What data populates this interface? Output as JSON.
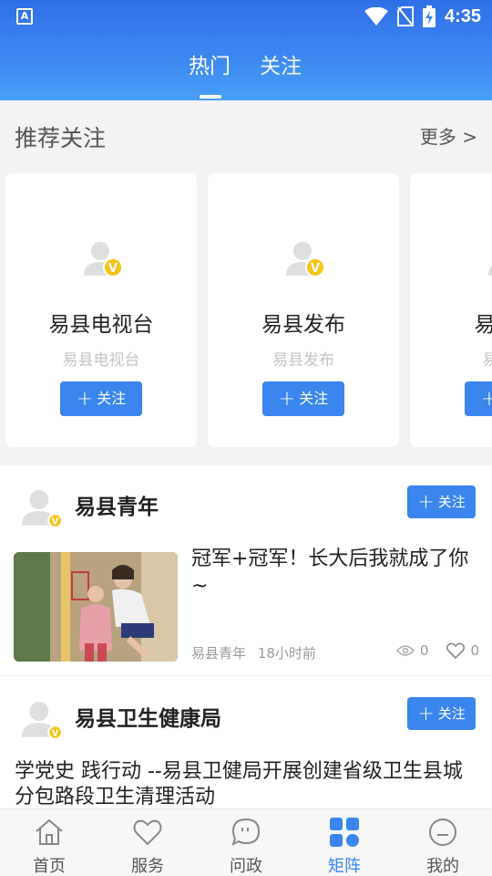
{
  "status_bar": {
    "time": "4:35",
    "app_icon_label": "A"
  },
  "tabs": [
    {
      "label": "热门"
    },
    {
      "label": "关注"
    }
  ],
  "recommend": {
    "title": "推荐关注",
    "more_label": "更多 >",
    "cards": [
      {
        "name": "易县电视台",
        "sub": "易县电视台",
        "button": "关注"
      },
      {
        "name": "易县发布",
        "sub": "易县发布",
        "button": "关注"
      },
      {
        "name": "易县文",
        "sub": "易县文",
        "button": "关注"
      }
    ]
  },
  "feed": {
    "items": [
      {
        "author": "易县青年",
        "follow_label": "关注",
        "title": "冠军+冠军！长大后我就成了你~",
        "source": "易县青年",
        "time": "18小时前",
        "views": "0",
        "likes": "0"
      },
      {
        "author": "易县卫生健康局",
        "follow_label": "关注",
        "title": "学党史  践行动 --易县卫健局开展创建省级卫生县城分包路段卫生清理活动"
      }
    ]
  },
  "bottom_nav": [
    {
      "label": "首页",
      "icon": "home-icon"
    },
    {
      "label": "服务",
      "icon": "heart-icon"
    },
    {
      "label": "问政",
      "icon": "chat-icon"
    },
    {
      "label": "矩阵",
      "icon": "grid-icon",
      "active": true
    },
    {
      "label": "我的",
      "icon": "profile-icon"
    }
  ],
  "colors": {
    "primary": "#3a85ee",
    "header_top": "#2f6fe6",
    "header_bottom": "#49a0f8",
    "badge": "#f5c518"
  }
}
